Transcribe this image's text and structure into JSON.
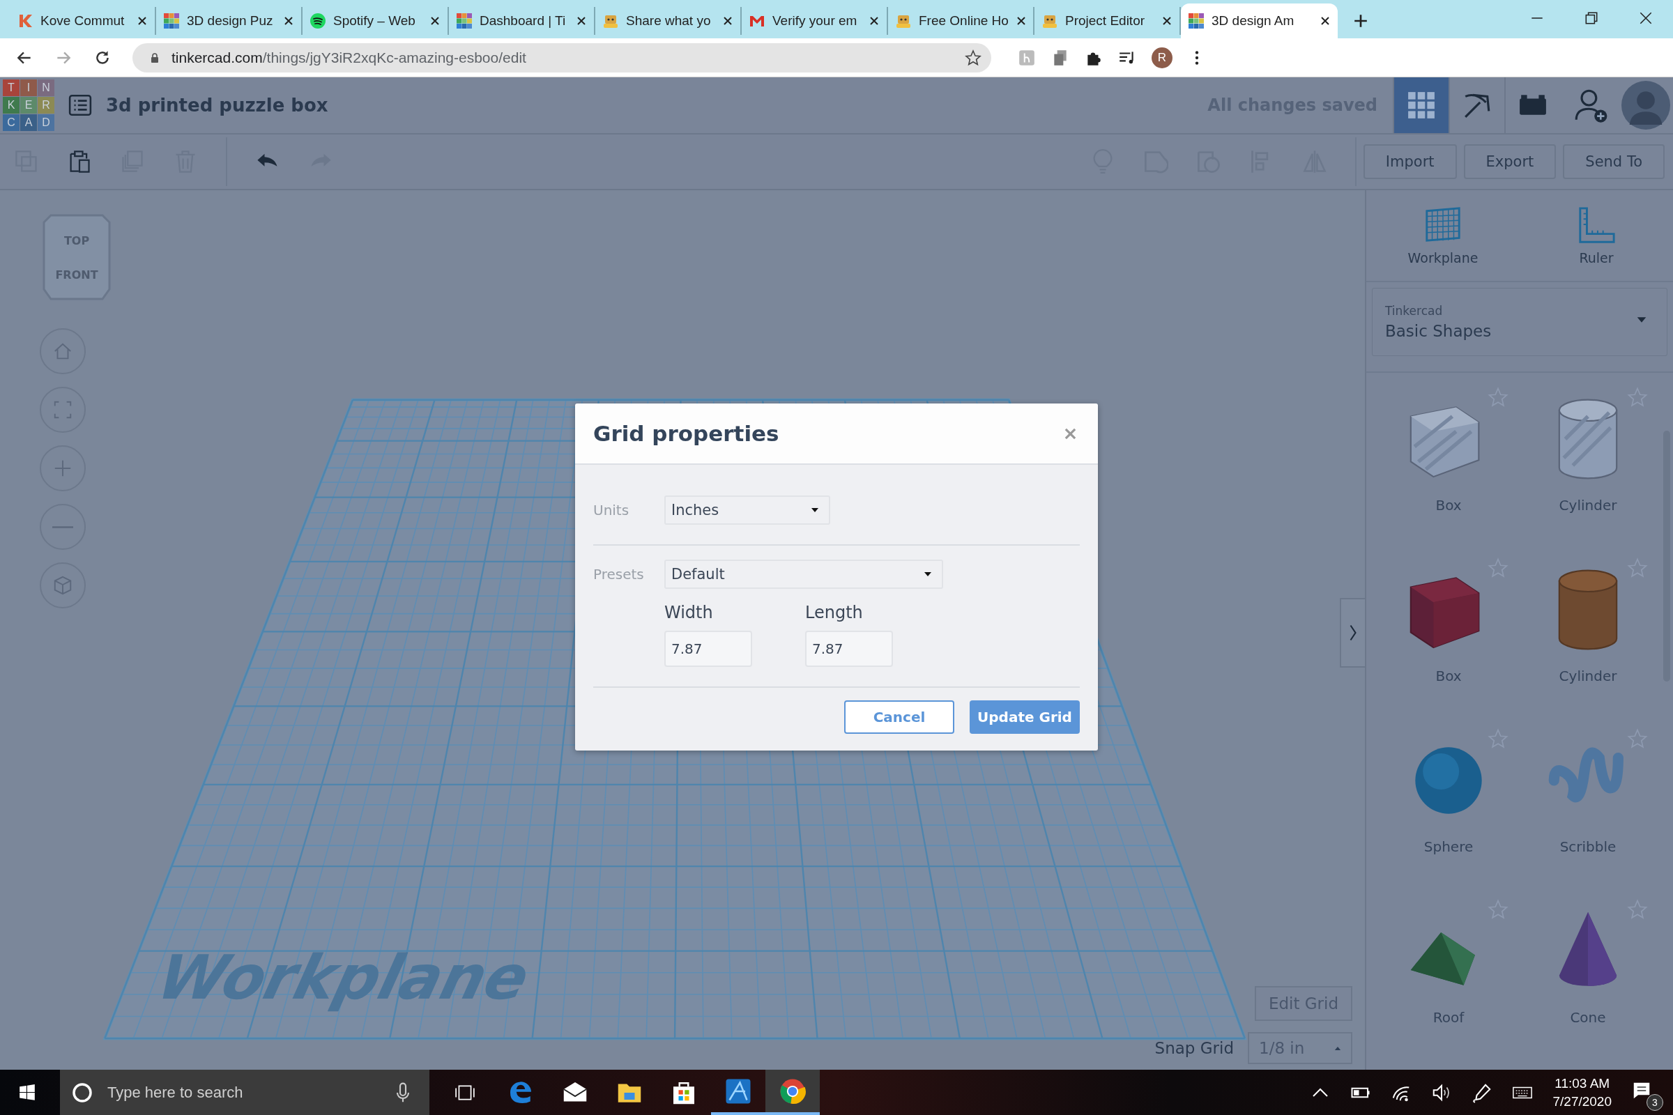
{
  "browser": {
    "tabs": [
      {
        "title": "Kove Commut",
        "kind": "k",
        "selected": false
      },
      {
        "title": "3D design Puz",
        "kind": "tinkercad",
        "selected": false
      },
      {
        "title": "Spotify – Web",
        "kind": "spotify",
        "selected": false
      },
      {
        "title": "Dashboard | Ti",
        "kind": "tinkercad",
        "selected": false
      },
      {
        "title": "Share what yo",
        "kind": "robot",
        "selected": false
      },
      {
        "title": "Verify your em",
        "kind": "gmail",
        "selected": false
      },
      {
        "title": "Free Online Ho",
        "kind": "robot",
        "selected": false
      },
      {
        "title": "Project Editor",
        "kind": "robot",
        "selected": false
      },
      {
        "title": "3D design Am",
        "kind": "tinkercad",
        "selected": true
      }
    ],
    "address_host": "tinkercad.com",
    "address_path": "/things/jgY3iR2xqKc-amazing-esboo/edit",
    "profile_initial": "R"
  },
  "app": {
    "logo": [
      {
        "letter": "T",
        "color": "#a8443b"
      },
      {
        "letter": "I",
        "color": "#8f5a4a"
      },
      {
        "letter": "N",
        "color": "#7a6b80"
      },
      {
        "letter": "K",
        "color": "#3f7a4e"
      },
      {
        "letter": "E",
        "color": "#5d8a6a"
      },
      {
        "letter": "R",
        "color": "#8c8a54"
      },
      {
        "letter": "C",
        "color": "#3b6a9c"
      },
      {
        "letter": "A",
        "color": "#3a6088"
      },
      {
        "letter": "D",
        "color": "#4d73a0"
      }
    ],
    "title": "3d printed puzzle box",
    "save_status": "All changes saved",
    "modes": [
      {
        "kind": "grid",
        "selected": true
      },
      {
        "kind": "pickaxe",
        "selected": false
      },
      {
        "kind": "bricks",
        "selected": false
      }
    ],
    "actions": [
      "Import",
      "Export",
      "Send To"
    ]
  },
  "view_cube": {
    "top": "TOP",
    "front": "FRONT"
  },
  "workplane_label": "Workplane",
  "dialog": {
    "title": "Grid properties",
    "units_label": "Units",
    "units_value": "Inches",
    "presets_label": "Presets",
    "presets_value": "Default",
    "width_label": "Width",
    "width_value": "7.87",
    "length_label": "Length",
    "length_value": "7.87",
    "cancel": "Cancel",
    "confirm": "Update Grid"
  },
  "panel": {
    "tools": [
      {
        "kind": "workplane",
        "label": "Workplane"
      },
      {
        "kind": "ruler",
        "label": "Ruler"
      }
    ],
    "library_caption": "Tinkercad",
    "library_value": "Basic Shapes",
    "shapes": [
      {
        "name": "Box",
        "kind": "box-hole"
      },
      {
        "name": "Cylinder",
        "kind": "cylinder-hole"
      },
      {
        "name": "Box",
        "kind": "box"
      },
      {
        "name": "Cylinder",
        "kind": "cylinder"
      },
      {
        "name": "Sphere",
        "kind": "sphere"
      },
      {
        "name": "Scribble",
        "kind": "scribble"
      },
      {
        "name": "Roof",
        "kind": "roof"
      },
      {
        "name": "Cone",
        "kind": "cone"
      }
    ]
  },
  "grid_controls": {
    "edit": "Edit Grid",
    "snap_label": "Snap Grid",
    "snap_value": "1/8 in"
  },
  "taskbar": {
    "search_placeholder": "Type here to search",
    "apps": [
      {
        "kind": "edge",
        "running": false,
        "selected": false
      },
      {
        "kind": "mail",
        "running": false,
        "selected": false
      },
      {
        "kind": "explorer",
        "running": false,
        "selected": false
      },
      {
        "kind": "store",
        "running": false,
        "selected": false
      },
      {
        "kind": "affinity",
        "running": true,
        "selected": false
      },
      {
        "kind": "chrome",
        "running": true,
        "selected": true
      }
    ],
    "time": "11:03 AM",
    "date": "7/27/2020",
    "notifications": "3"
  }
}
